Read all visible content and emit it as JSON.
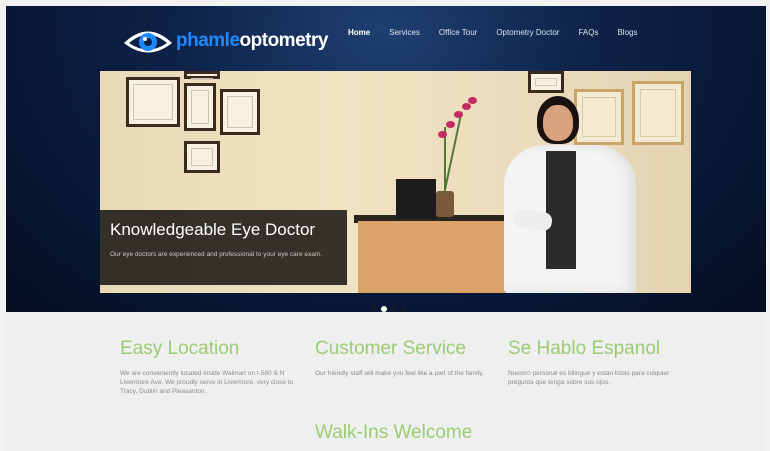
{
  "brand": {
    "logo_part1": "phamle",
    "logo_part2": "optometry"
  },
  "nav": {
    "items": [
      "Home",
      "Services",
      "Office Tour",
      "Optometry Doctor",
      "FAQs",
      "Blogs"
    ],
    "active": "Home"
  },
  "slider": {
    "caption_title": "Knowledgeable Eye Doctor",
    "caption_text": "Our eye doctors are experienced and professional to your eye care exam.",
    "dot_count": 4,
    "active_dot": 2
  },
  "features": [
    {
      "title": "Easy Location",
      "text": "We are conveniently located inside Walmart on I-580 & N Livermore Ave.  We proudly serve in Livermore, very close to Tracy, Dublin and Pleasanton."
    },
    {
      "title": "Customer Service",
      "text": "Our friendly staff will make you feel like a part of the family."
    },
    {
      "title": "Se Hablo Espanol",
      "text": "Nuestro personal es bilingue y estan listas para culquier pregunta que tenga sobre sus ojos."
    }
  ],
  "walkins": {
    "title": "Walk-Ins Welcome"
  },
  "colors": {
    "header_bg": "#0b1b3a",
    "accent_green": "#9acd73",
    "logo_blue": "#1e88ff"
  }
}
